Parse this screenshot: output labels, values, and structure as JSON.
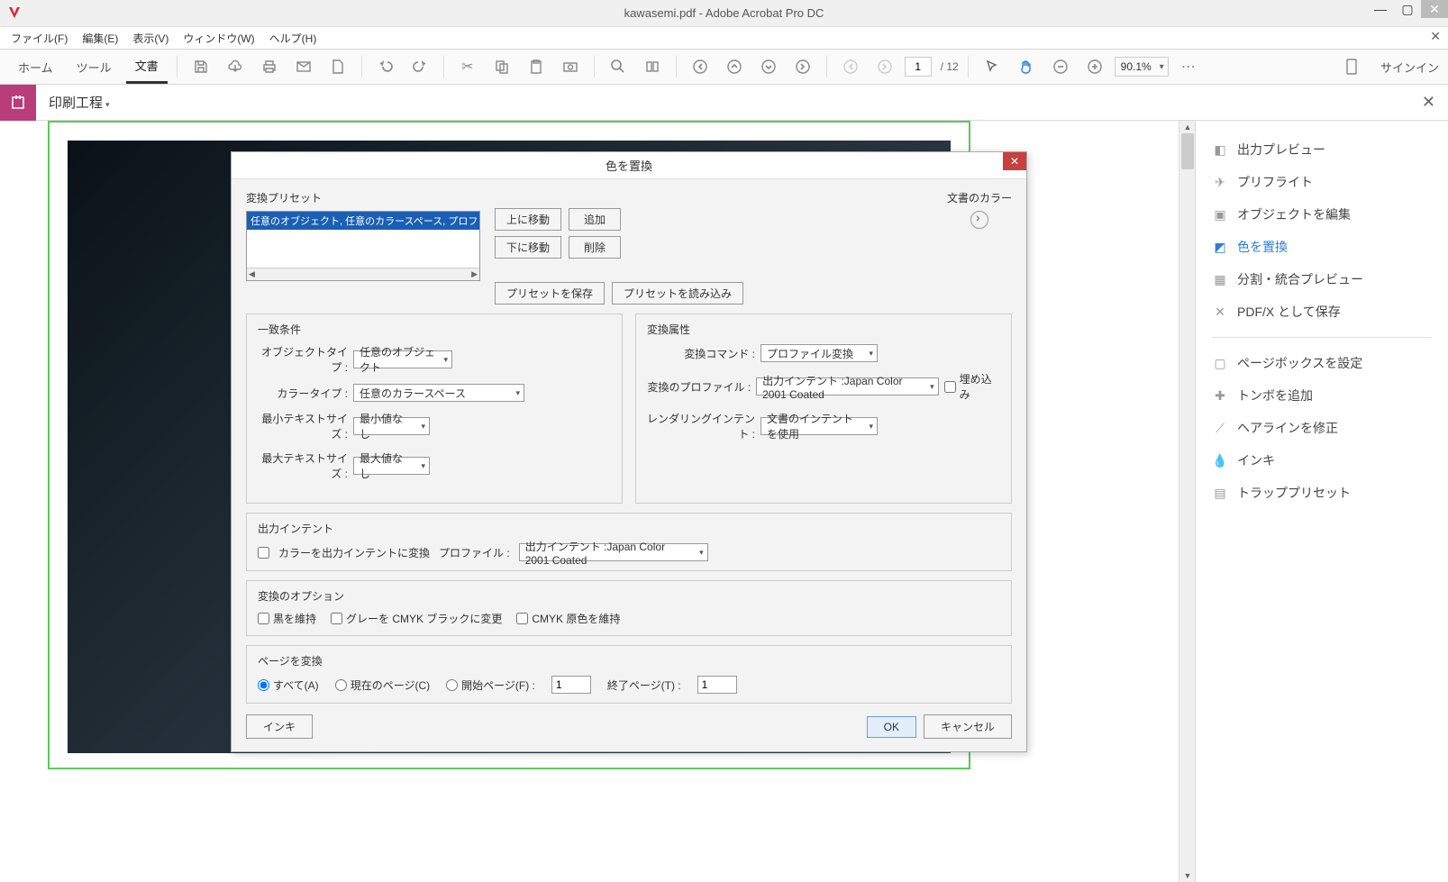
{
  "window": {
    "title": "kawasemi.pdf - Adobe Acrobat Pro DC"
  },
  "menu": {
    "file": "ファイル(F)",
    "edit": "編集(E)",
    "view": "表示(V)",
    "window": "ウィンドウ(W)",
    "help": "ヘルプ(H)"
  },
  "tabs": {
    "home": "ホーム",
    "tool": "ツール",
    "document": "文書"
  },
  "page": {
    "current": "1",
    "total": "/ 12"
  },
  "zoom": {
    "value": "90.1%"
  },
  "signin": "サインイン",
  "panel": {
    "title": "印刷工程"
  },
  "right_panel": {
    "items": [
      "出力プレビュー",
      "プリフライト",
      "オブジェクトを編集",
      "色を置換",
      "分割・統合プレビュー",
      "PDF/X として保存",
      "ページボックスを設定",
      "トンボを追加",
      "ヘアラインを修正",
      "インキ",
      "トラッププリセット"
    ]
  },
  "dialog": {
    "title": "色を置換",
    "preset_section": "変換プリセット",
    "preset_item": "任意のオブジェクト, 任意のカラースペース, プロファイル変換",
    "doc_color": "文書のカラー",
    "btn_up": "上に移動",
    "btn_add": "追加",
    "btn_down": "下に移動",
    "btn_delete": "削除",
    "btn_save_preset": "プリセットを保存",
    "btn_load_preset": "プリセットを読み込み",
    "match_section": "一致条件",
    "object_type_label": "オブジェクトタイプ :",
    "object_type_value": "任意のオブジェクト",
    "color_type_label": "カラータイプ :",
    "color_type_value": "任意のカラースペース",
    "min_text_label": "最小テキストサイズ :",
    "min_text_value": "最小値なし",
    "max_text_label": "最大テキストサイズ :",
    "max_text_value": "最大値なし",
    "attr_section": "変換属性",
    "cmd_label": "変換コマンド :",
    "cmd_value": "プロファイル変換",
    "profile_label": "変換のプロファイル :",
    "profile_value": "出力インテント :Japan Color 2001 Coated",
    "embed": "埋め込み",
    "render_label": "レンダリングインテント :",
    "render_value": "文書のインテントを使用",
    "output_intent_section": "出力インテント",
    "convert_to_output": "カラーを出力インテントに変換",
    "output_profile_label": "プロファイル :",
    "output_profile_value": "出力インテント :Japan Color 2001 Coated",
    "options_section": "変換のオプション",
    "keep_black": "黒を維持",
    "gray_to_cmyk": "グレーを CMYK ブラックに変更",
    "keep_cmyk": "CMYK 原色を維持",
    "pages_section": "ページを変換",
    "all_pages": "すべて(A)",
    "current_page": "現在のページ(C)",
    "start_page": "開始ページ(F) :",
    "end_page": "終了ページ(T) :",
    "start_val": "1",
    "end_val": "1",
    "ink_btn": "インキ",
    "ok": "OK",
    "cancel": "キャンセル"
  }
}
